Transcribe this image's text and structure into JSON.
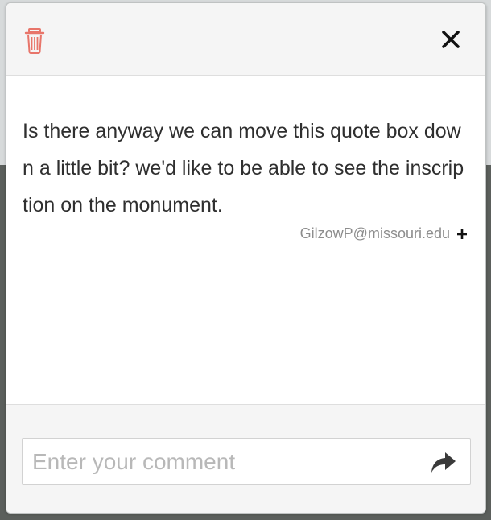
{
  "dialog": {
    "comment": {
      "text": "Is there anyway we can move this quote box down a little bit? we'd like to be able to see the inscription on the monument.",
      "author": "GilzowP@missouri.edu"
    },
    "input": {
      "placeholder": "Enter your comment",
      "value": ""
    }
  },
  "icons": {
    "delete": "trash-icon",
    "close": "close-icon",
    "expand": "plus-icon",
    "send": "share-arrow-icon"
  },
  "colors": {
    "trash": "#e8756a",
    "text": "#2f2f2f",
    "author": "#8d8d8d",
    "placeholder": "#b8b8b8"
  }
}
